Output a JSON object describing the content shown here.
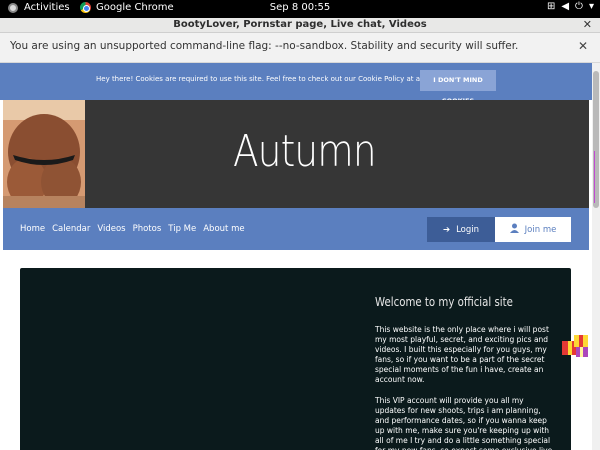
{
  "system": {
    "activities": "Activities",
    "app_name": "Google Chrome",
    "clock": "Sep 8  00:55"
  },
  "window": {
    "title": "BootyLover, Pornstar page, Live chat, Videos"
  },
  "infobar": {
    "message": "You are using an unsupported command-line flag: --no-sandbox. Stability and security will suffer."
  },
  "cookie_banner": {
    "text": "Hey there! Cookies are required to use this site. Feel free to check out our Cookie Policy at any time.",
    "button": "I DON'T MIND COOKIES"
  },
  "hero": {
    "name": "Autumn"
  },
  "nav": {
    "items": [
      "Home",
      "Calendar",
      "Videos",
      "Photos",
      "Tip Me",
      "About me"
    ],
    "login": "Login",
    "join": "Join me"
  },
  "welcome": {
    "heading": "Welcome to my official site",
    "paragraph1": "This website is the only place where i will post my most playful, secret, and exciting pics and videos. I built this especially for you guys, my fans, so if you want to be a part of the secret special moments of the fun i have, create an account now.",
    "paragraph2": "This VIP account will provide you all my updates for new shoots, trips i am planning, and performance dates, so if you wanna keep up with me, make sure you're keeping up with all of me I try and do a little something special for my new fans, so expect some exclusive live"
  },
  "colors": {
    "brand_blue": "#5b7fbf",
    "hero_bg": "#363636",
    "content_bg": "#0b1a1c"
  }
}
